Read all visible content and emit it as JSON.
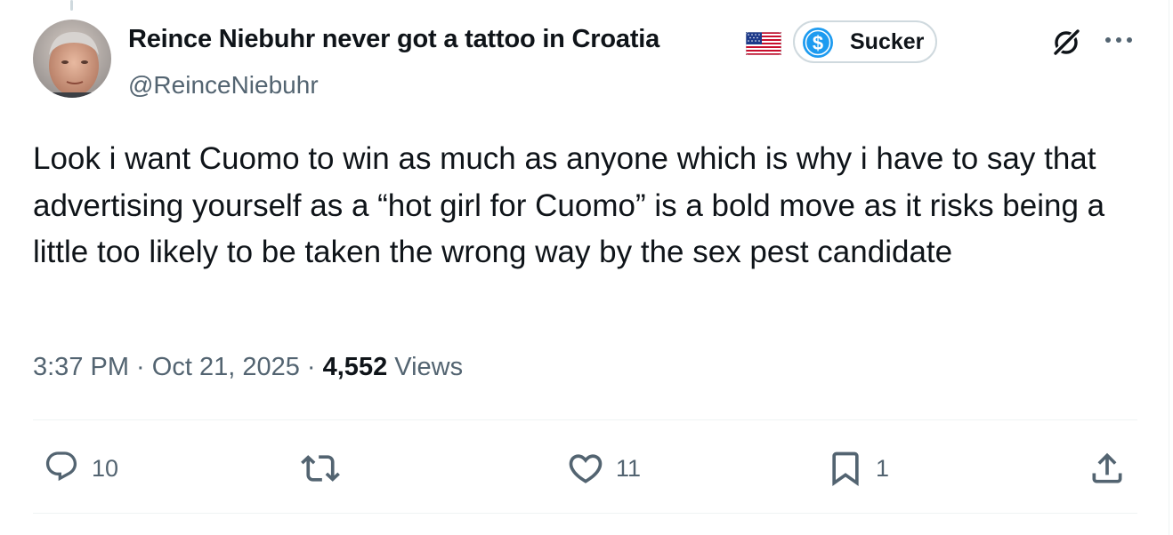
{
  "author": {
    "display_name": "Reince Niebuhr never got a tattoo in Croatia",
    "handle": "@ReinceNiebuhr",
    "flag_icon": "us-flag-icon",
    "badge_label": "Sucker",
    "badge_icon": "dollar-coin-icon"
  },
  "tweet": {
    "text": "Look i want Cuomo to win as much as anyone which is why i have to say that advertising yourself as a “hot girl for Cuomo” is a bold move as it risks being a little too likely to be taken the wrong way by the sex pest candidate",
    "time": "3:37 PM",
    "separator1": " · ",
    "date": "Oct 21, 2025",
    "separator2": " · ",
    "views_count": "4,552",
    "views_label": " Views"
  },
  "actions": {
    "replies": "10",
    "reposts": "",
    "likes": "11",
    "bookmarks": "1"
  },
  "colors": {
    "text_primary": "#0f1419",
    "text_secondary": "#536471",
    "divider": "#eff3f4",
    "coin_blue": "#1d9bf0"
  }
}
